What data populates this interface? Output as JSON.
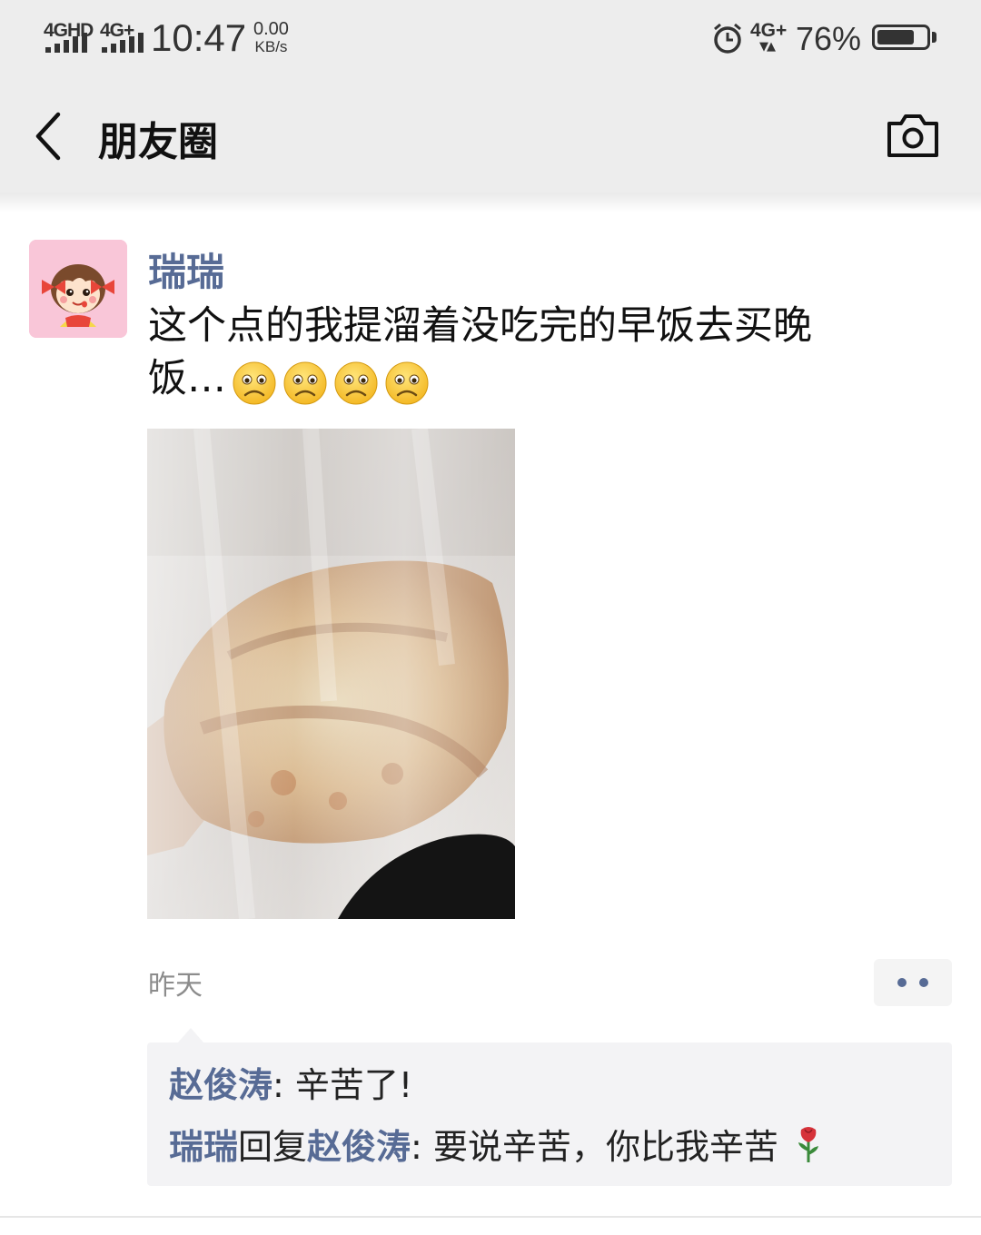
{
  "status_bar": {
    "sim1_label": "4GHD",
    "sim2_label": "4G+",
    "time": "10:47",
    "net_speed_value": "0.00",
    "net_speed_unit": "KB/s",
    "data_label": "4G+",
    "battery_percent": "76%",
    "battery_level": 0.76,
    "icons": [
      "signal-icon",
      "alarm-icon",
      "battery-icon"
    ]
  },
  "nav": {
    "title": "朋友圈",
    "back_icon": "back-arrow-icon",
    "camera_icon": "camera-icon"
  },
  "post": {
    "author": "瑞瑞",
    "text": "这个点的我提溜着没吃完的早饭去买晚饭…",
    "emoji_icon": "sad-face-emoji-icon",
    "emoji_count": 4,
    "time": "昨天"
  },
  "comments": [
    {
      "author": "赵俊涛",
      "sep": ": ",
      "text": "辛苦了!"
    },
    {
      "author": "瑞瑞",
      "reply_word": "回复",
      "reply_to": "赵俊涛",
      "sep": ": ",
      "text": "要说辛苦，你比我辛苦"
    }
  ],
  "colors": {
    "link_blue": "#576b95",
    "topbar_bg": "#ededed",
    "comment_bg": "#f3f3f5",
    "time_gray": "#8c8c8c"
  }
}
